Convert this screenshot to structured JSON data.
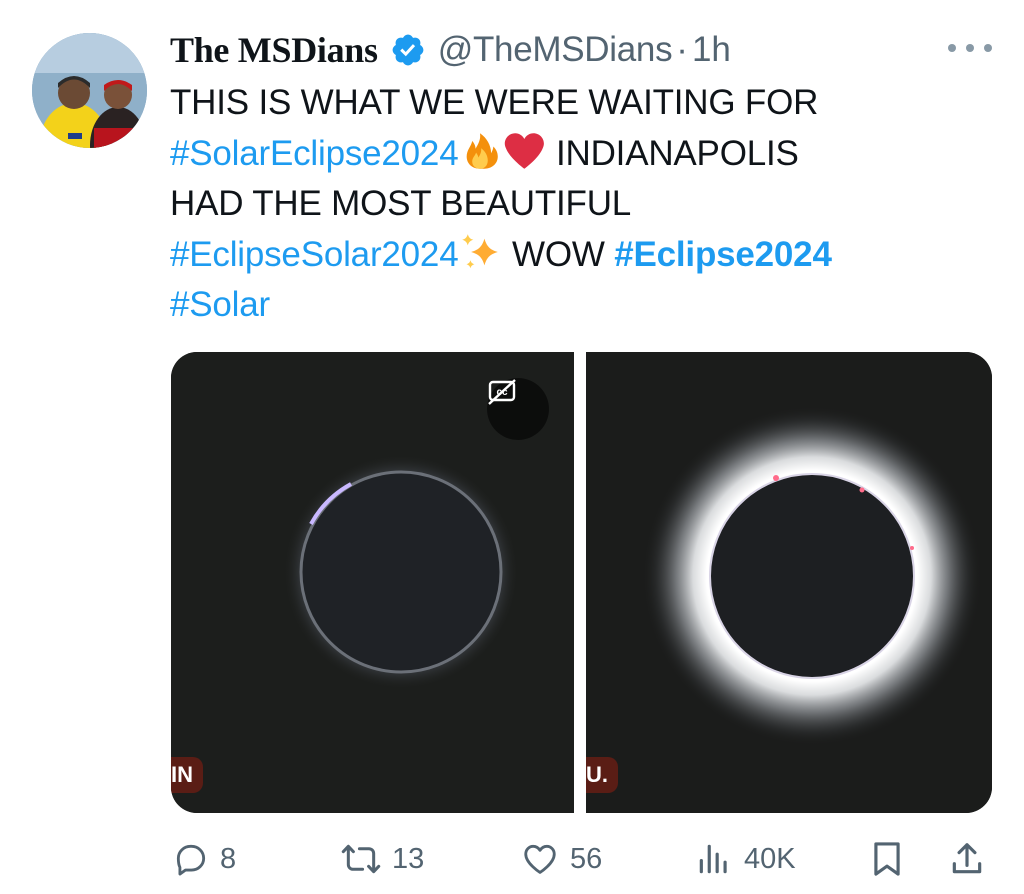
{
  "tweet": {
    "author_name": "The MSDians",
    "handle": "@TheMSDians",
    "separator": "·",
    "time": "1h",
    "text_lines": [
      [
        {
          "t": "THIS IS WHAT WE WERE WAITING FOR"
        }
      ],
      [
        {
          "t": "#SolarEclipse2024",
          "tag": true
        },
        {
          "emoji": "fire"
        },
        {
          "emoji": "heart"
        },
        {
          "t": " INDIANAPOLIS"
        }
      ],
      [
        {
          "t": "HAD THE MOST BEAUTIFUL"
        }
      ],
      [
        {
          "t": "#EclipseSolar2024",
          "tag": true
        },
        {
          "emoji": "sparkles"
        },
        {
          "t": " WOW "
        },
        {
          "t": "#Eclipse2024",
          "tag": true,
          "bold": true
        }
      ],
      [
        {
          "t": "#Solar",
          "tag": true
        }
      ]
    ]
  },
  "media": {
    "left_label": "IN",
    "right_label": "U.",
    "left_icon": "captions-off-icon"
  },
  "actions": {
    "replies": "8",
    "retweets": "13",
    "likes": "56",
    "views": "40K"
  },
  "colors": {
    "link": "#1d9bf0",
    "muted": "#536471",
    "verified": "#1d9bf0",
    "text": "#0f1419"
  },
  "icons": {
    "verified": "verified-badge-icon",
    "more": "more-dots-icon",
    "reply": "reply-icon",
    "retweet": "retweet-icon",
    "like": "heart-icon",
    "views": "views-icon",
    "bookmark": "bookmark-icon",
    "share": "share-icon"
  }
}
